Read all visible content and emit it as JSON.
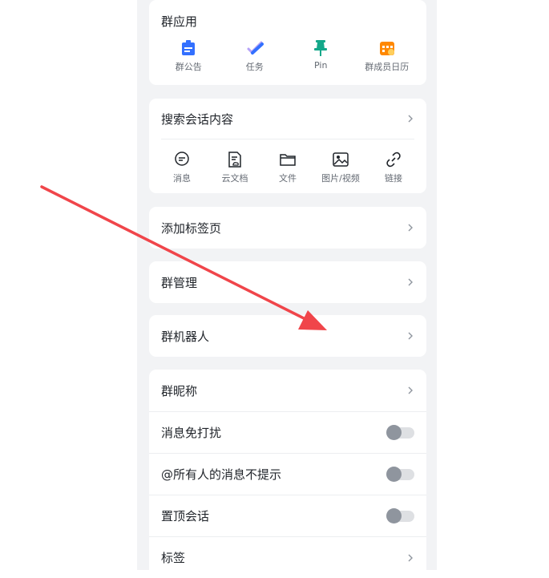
{
  "group_apps": {
    "title": "群应用",
    "items": [
      {
        "label": "群公告",
        "icon": "announcement-icon",
        "color": "#3370ff"
      },
      {
        "label": "任务",
        "icon": "task-icon",
        "color": "#3370ff"
      },
      {
        "label": "Pin",
        "icon": "pin-icon",
        "color": "#14a88a"
      },
      {
        "label": "群成员日历",
        "icon": "calendar-icon",
        "color": "#ff8800"
      }
    ]
  },
  "search": {
    "title": "搜索会话内容",
    "items": [
      {
        "label": "消息",
        "icon": "message-icon"
      },
      {
        "label": "云文档",
        "icon": "cloud-doc-icon"
      },
      {
        "label": "文件",
        "icon": "folder-icon"
      },
      {
        "label": "图片/视频",
        "icon": "image-icon"
      },
      {
        "label": "链接",
        "icon": "link-icon"
      }
    ]
  },
  "rows": {
    "add_tab": "添加标签页",
    "group_manage": "群管理",
    "group_bot": "群机器人",
    "group_nickname": "群昵称",
    "mute": "消息免打扰",
    "at_all_mute": "@所有人的消息不提示",
    "pin_chat": "置顶会话",
    "tags": "标签"
  },
  "toggles": {
    "mute": false,
    "at_all_mute": false,
    "pin_chat": false
  },
  "colors": {
    "arrow": "#f0454a",
    "toggle_off": "#8f959e"
  }
}
